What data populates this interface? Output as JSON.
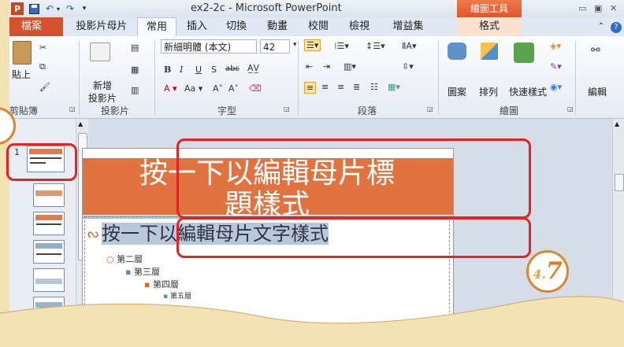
{
  "window": {
    "title": "ex2-2c - Microsoft PowerPoint",
    "context_tools": "繪圖工具",
    "ppt_logo": "P"
  },
  "tabs": {
    "file": "檔案",
    "items": [
      "投影片母片",
      "常用",
      "插入",
      "切換",
      "動畫",
      "校閱",
      "檢視",
      "增益集",
      "格式"
    ],
    "active": "常用"
  },
  "ribbon": {
    "clipboard": {
      "label": "剪貼簿",
      "paste": "貼上"
    },
    "slides": {
      "label": "投影片",
      "new_slide_1": "新增",
      "new_slide_2": "投影片"
    },
    "font": {
      "label": "字型",
      "font_name": "新細明體 (本文)",
      "font_size": "42"
    },
    "paragraph": {
      "label": "段落"
    },
    "drawing": {
      "label": "繪圖",
      "shapes": "圖案",
      "arrange": "排列",
      "quick_styles": "快速樣式"
    },
    "editing": {
      "label": "編輯",
      "edit": "編輯"
    }
  },
  "thumbnails": {
    "first_number": "1"
  },
  "slide": {
    "title_line1": "按一下以編輯母片標",
    "title_line2": "題樣式",
    "body_level1": "按一下以編輯母片文字樣式",
    "level2": "第二層",
    "level3": "第三層",
    "level4": "第四層",
    "level5": "第五層"
  },
  "callout": {
    "step_prefix": "4.",
    "step_number": "7"
  },
  "colors": {
    "accent": "#e0733f",
    "highlight": "#e52421",
    "callout": "#e67a1e"
  }
}
